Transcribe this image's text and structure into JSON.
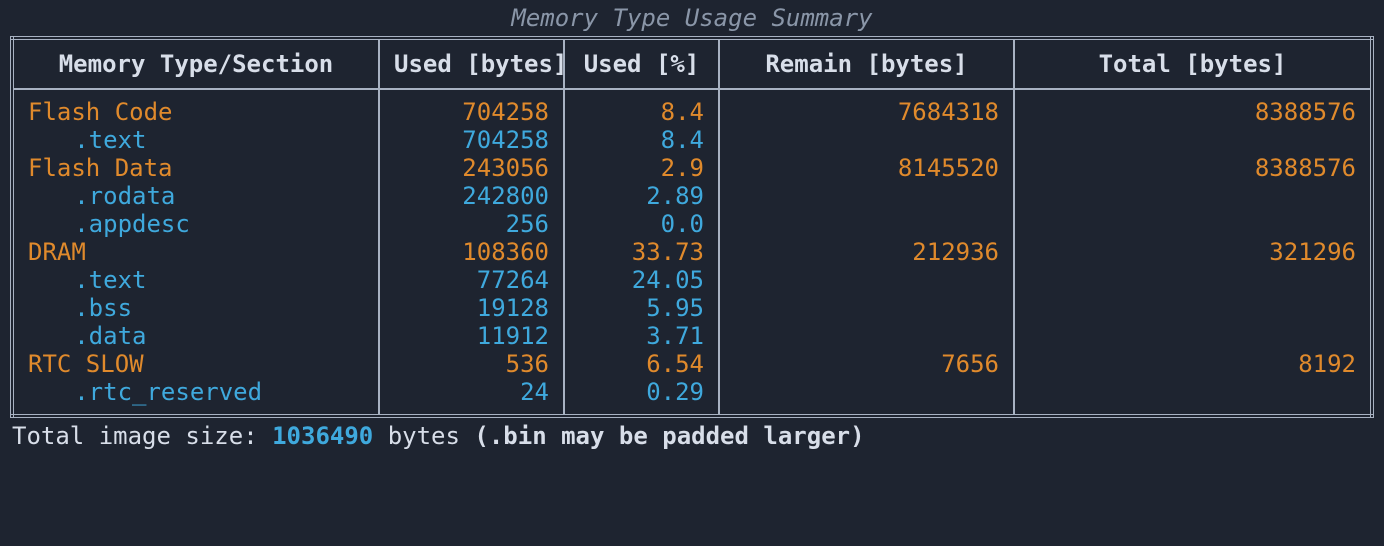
{
  "title": "Memory Type Usage Summary",
  "headers": {
    "section": "Memory Type/Section",
    "used": "Used [bytes]",
    "pct": "Used [%]",
    "remain": "Remain [bytes]",
    "total": "Total [bytes]"
  },
  "rows": [
    {
      "kind": "type",
      "label": "Flash Code",
      "used": "704258",
      "pct": "8.4",
      "remain": "7684318",
      "total": "8388576"
    },
    {
      "kind": "section",
      "label": ".text",
      "used": "704258",
      "pct": "8.4",
      "remain": "",
      "total": ""
    },
    {
      "kind": "type",
      "label": "Flash Data",
      "used": "243056",
      "pct": "2.9",
      "remain": "8145520",
      "total": "8388576"
    },
    {
      "kind": "section",
      "label": ".rodata",
      "used": "242800",
      "pct": "2.89",
      "remain": "",
      "total": ""
    },
    {
      "kind": "section",
      "label": ".appdesc",
      "used": "256",
      "pct": "0.0",
      "remain": "",
      "total": ""
    },
    {
      "kind": "type",
      "label": "DRAM",
      "used": "108360",
      "pct": "33.73",
      "remain": "212936",
      "total": "321296"
    },
    {
      "kind": "section",
      "label": ".text",
      "used": "77264",
      "pct": "24.05",
      "remain": "",
      "total": ""
    },
    {
      "kind": "section",
      "label": ".bss",
      "used": "19128",
      "pct": "5.95",
      "remain": "",
      "total": ""
    },
    {
      "kind": "section",
      "label": ".data",
      "used": "11912",
      "pct": "3.71",
      "remain": "",
      "total": ""
    },
    {
      "kind": "type",
      "label": "RTC SLOW",
      "used": "536",
      "pct": "6.54",
      "remain": "7656",
      "total": "8192"
    },
    {
      "kind": "section",
      "label": ".rtc_reserved",
      "used": "24",
      "pct": "0.29",
      "remain": "",
      "total": ""
    }
  ],
  "footer": {
    "prefix": "Total image size: ",
    "value": "1036490",
    "suffix": " bytes ",
    "note": "(.bin may be padded larger)"
  },
  "colors": {
    "bg": "#1e2430",
    "border": "#a8b2c2",
    "fg": "#d8dee9",
    "type": "#e08a2c",
    "section": "#3fa9dd"
  }
}
